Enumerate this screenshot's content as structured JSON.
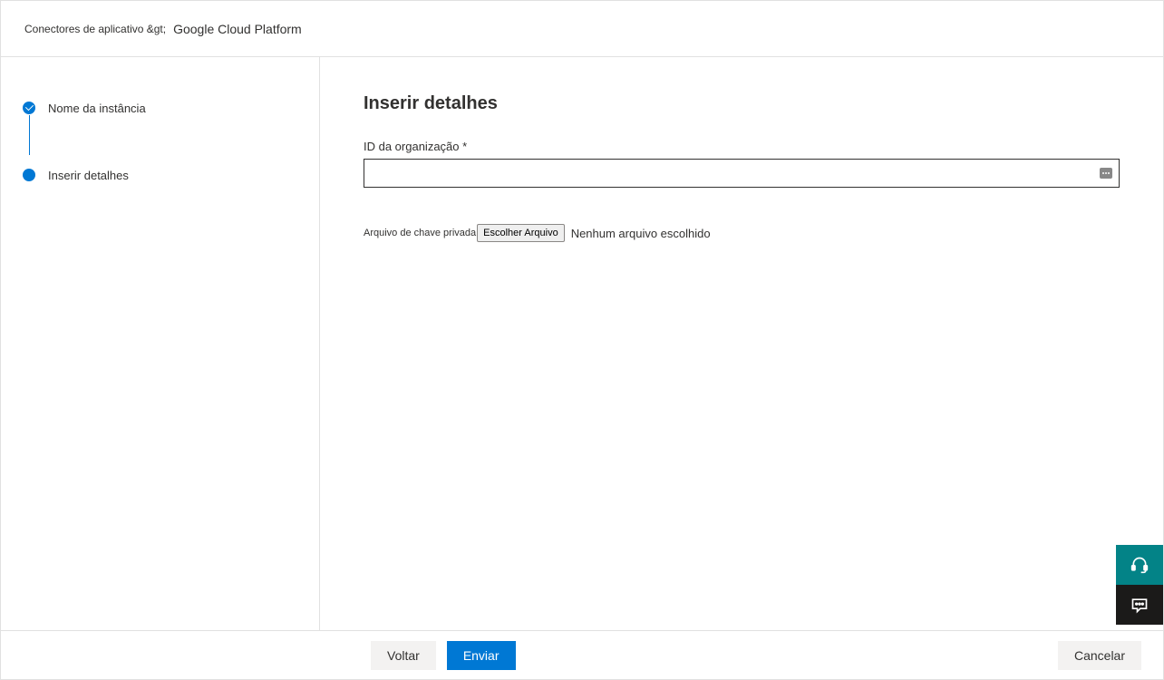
{
  "breadcrumb": {
    "root": "Conectores de aplicativo &gt;",
    "current": "Google Cloud Platform"
  },
  "steps": [
    {
      "label": "Nome da instância",
      "state": "complete"
    },
    {
      "label": "Inserir detalhes",
      "state": "current"
    }
  ],
  "main": {
    "title": "Inserir detalhes",
    "org_id_label": "ID da organização *",
    "org_id_value": "",
    "file_label": "Arquivo de chave privada",
    "file_button": "Escolher Arquivo",
    "file_status": "Nenhum arquivo escolhido"
  },
  "footer": {
    "back": "Voltar",
    "submit": "Enviar",
    "cancel": "Cancelar"
  }
}
